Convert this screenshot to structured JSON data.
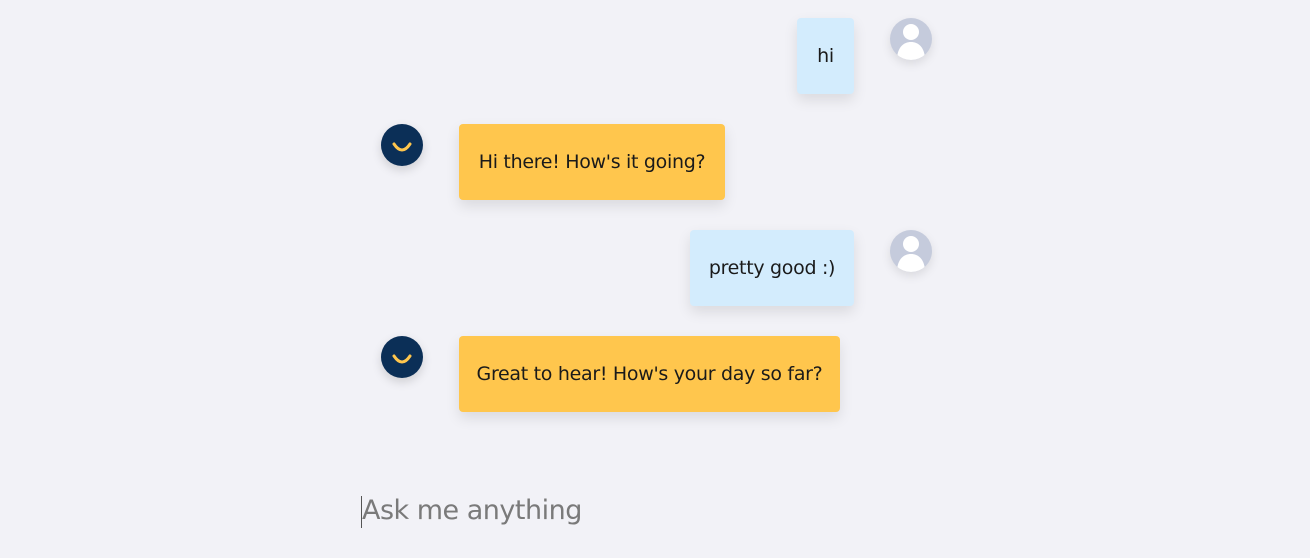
{
  "messages": [
    {
      "sender": "user",
      "text": "hi"
    },
    {
      "sender": "bot",
      "text": "Hi there! How's it going?"
    },
    {
      "sender": "user",
      "text": "pretty good :)"
    },
    {
      "sender": "bot",
      "text": "Great to hear! How's your day so far?"
    }
  ],
  "composer": {
    "placeholder": "Ask me anything",
    "value": ""
  },
  "colors": {
    "background": "#f2f2f7",
    "user_bubble": "#d3ecfd",
    "bot_bubble": "#ffc64d",
    "bot_avatar": "#0b2f57",
    "bot_smile": "#ffc64d",
    "user_avatar": "#c5cbdc"
  },
  "icons": {
    "user_avatar": "user-silhouette-icon",
    "bot_avatar": "smile-logo-icon"
  }
}
